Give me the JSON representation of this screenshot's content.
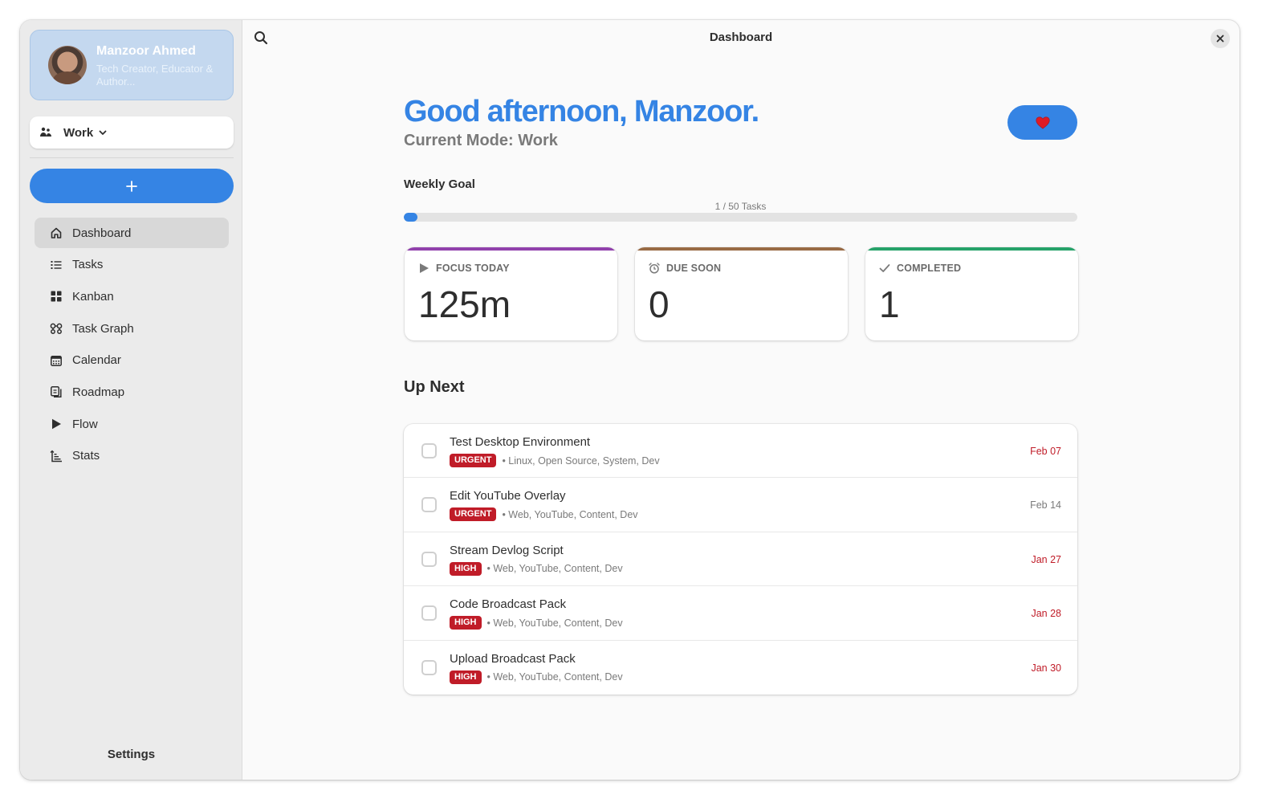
{
  "window": {
    "title": "Dashboard"
  },
  "profile": {
    "name": "Manzoor Ahmed",
    "role": "Tech Creator, Educator & Author..."
  },
  "mode_selector": {
    "label": "Work"
  },
  "add_button": {
    "icon": "plus-icon"
  },
  "nav": {
    "items": [
      {
        "label": "Dashboard",
        "icon": "home-icon",
        "active": true
      },
      {
        "label": "Tasks",
        "icon": "list-icon",
        "active": false
      },
      {
        "label": "Kanban",
        "icon": "grid-icon",
        "active": false
      },
      {
        "label": "Task Graph",
        "icon": "graph-icon",
        "active": false
      },
      {
        "label": "Calendar",
        "icon": "calendar-icon",
        "active": false
      },
      {
        "label": "Roadmap",
        "icon": "roadmap-icon",
        "active": false
      },
      {
        "label": "Flow",
        "icon": "play-icon",
        "active": false
      },
      {
        "label": "Stats",
        "icon": "stats-icon",
        "active": false
      }
    ]
  },
  "settings_label": "Settings",
  "greeting": "Good afternoon, Manzoor.",
  "current_mode": "Current Mode: Work",
  "weekly_goal": {
    "label": "Weekly Goal",
    "text": "1 / 50 Tasks",
    "completed": 1,
    "total": 50
  },
  "stats": [
    {
      "label": "FOCUS TODAY",
      "value": "125m",
      "icon": "play-icon",
      "accent": "#9141ac"
    },
    {
      "label": "DUE SOON",
      "value": "0",
      "icon": "alarm-icon",
      "accent": "#986a44"
    },
    {
      "label": "COMPLETED",
      "value": "1",
      "icon": "check-icon",
      "accent": "#26a269"
    }
  ],
  "up_next": {
    "title": "Up Next",
    "tasks": [
      {
        "title": "Test Desktop Environment",
        "priority": "URGENT",
        "tags": "• Linux, Open Source, System, Dev",
        "date": "Feb 07",
        "date_color": "#c01c28"
      },
      {
        "title": "Edit YouTube Overlay",
        "priority": "URGENT",
        "tags": "• Web, YouTube, Content, Dev",
        "date": "Feb 14",
        "date_color": "#7a7a7a"
      },
      {
        "title": "Stream Devlog Script",
        "priority": "HIGH",
        "tags": "• Web, YouTube, Content, Dev",
        "date": "Jan 27",
        "date_color": "#c01c28"
      },
      {
        "title": "Code Broadcast Pack",
        "priority": "HIGH",
        "tags": "• Web, YouTube, Content, Dev",
        "date": "Jan 28",
        "date_color": "#c01c28"
      },
      {
        "title": "Upload Broadcast Pack",
        "priority": "HIGH",
        "tags": "• Web, YouTube, Content, Dev",
        "date": "Jan 30",
        "date_color": "#c01c28"
      }
    ]
  },
  "colors": {
    "accent": "#3584e4",
    "urgent": "#c01c28"
  }
}
